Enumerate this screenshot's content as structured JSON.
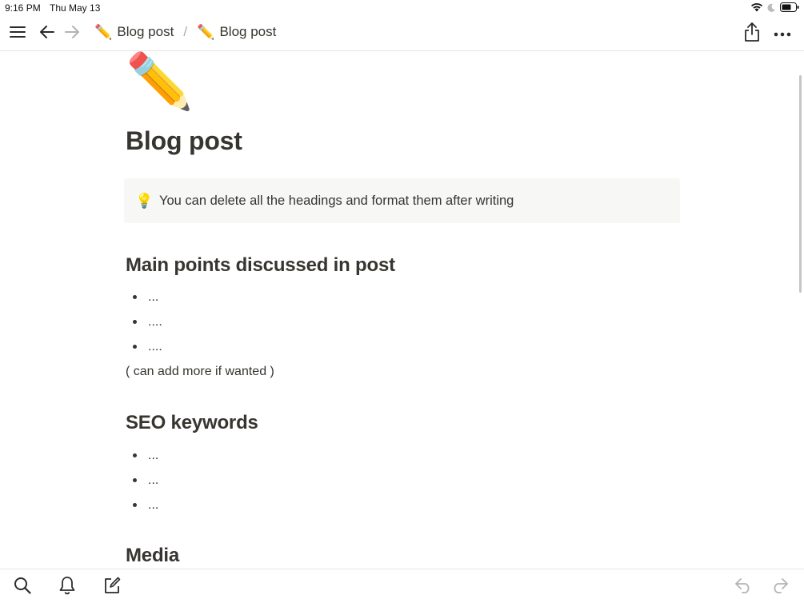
{
  "status_bar": {
    "time": "9:16 PM",
    "date": "Thu May 13",
    "icons": [
      "wifi-icon",
      "moon-icon",
      "battery-icon"
    ]
  },
  "toolbar": {
    "icons": [
      "menu-icon",
      "back-arrow-icon",
      "forward-arrow-icon",
      "share-icon",
      "more-icon"
    ],
    "breadcrumbs": [
      {
        "emoji": "✏️",
        "label": "Blog post"
      },
      {
        "emoji": "✏️",
        "label": "Blog post"
      }
    ],
    "separator": "/"
  },
  "page": {
    "icon": "✏️",
    "title": "Blog post",
    "callout": {
      "icon": "💡",
      "text": "You can delete all the headings and format them after writing"
    },
    "sections": [
      {
        "heading": "Main points discussed in post",
        "bullets": [
          "...",
          "....",
          "...."
        ],
        "note": "( can add more if wanted )"
      },
      {
        "heading": "SEO keywords",
        "bullets": [
          "...",
          "...",
          "..."
        ]
      },
      {
        "heading": "Media"
      }
    ]
  },
  "bottom_bar": {
    "icons": [
      "search-icon",
      "bell-icon",
      "compose-icon",
      "undo-icon",
      "redo-icon"
    ]
  },
  "colors": {
    "text": "#37352f",
    "callout_bg": "#f7f7f5",
    "divider": "#e6e6e6"
  }
}
